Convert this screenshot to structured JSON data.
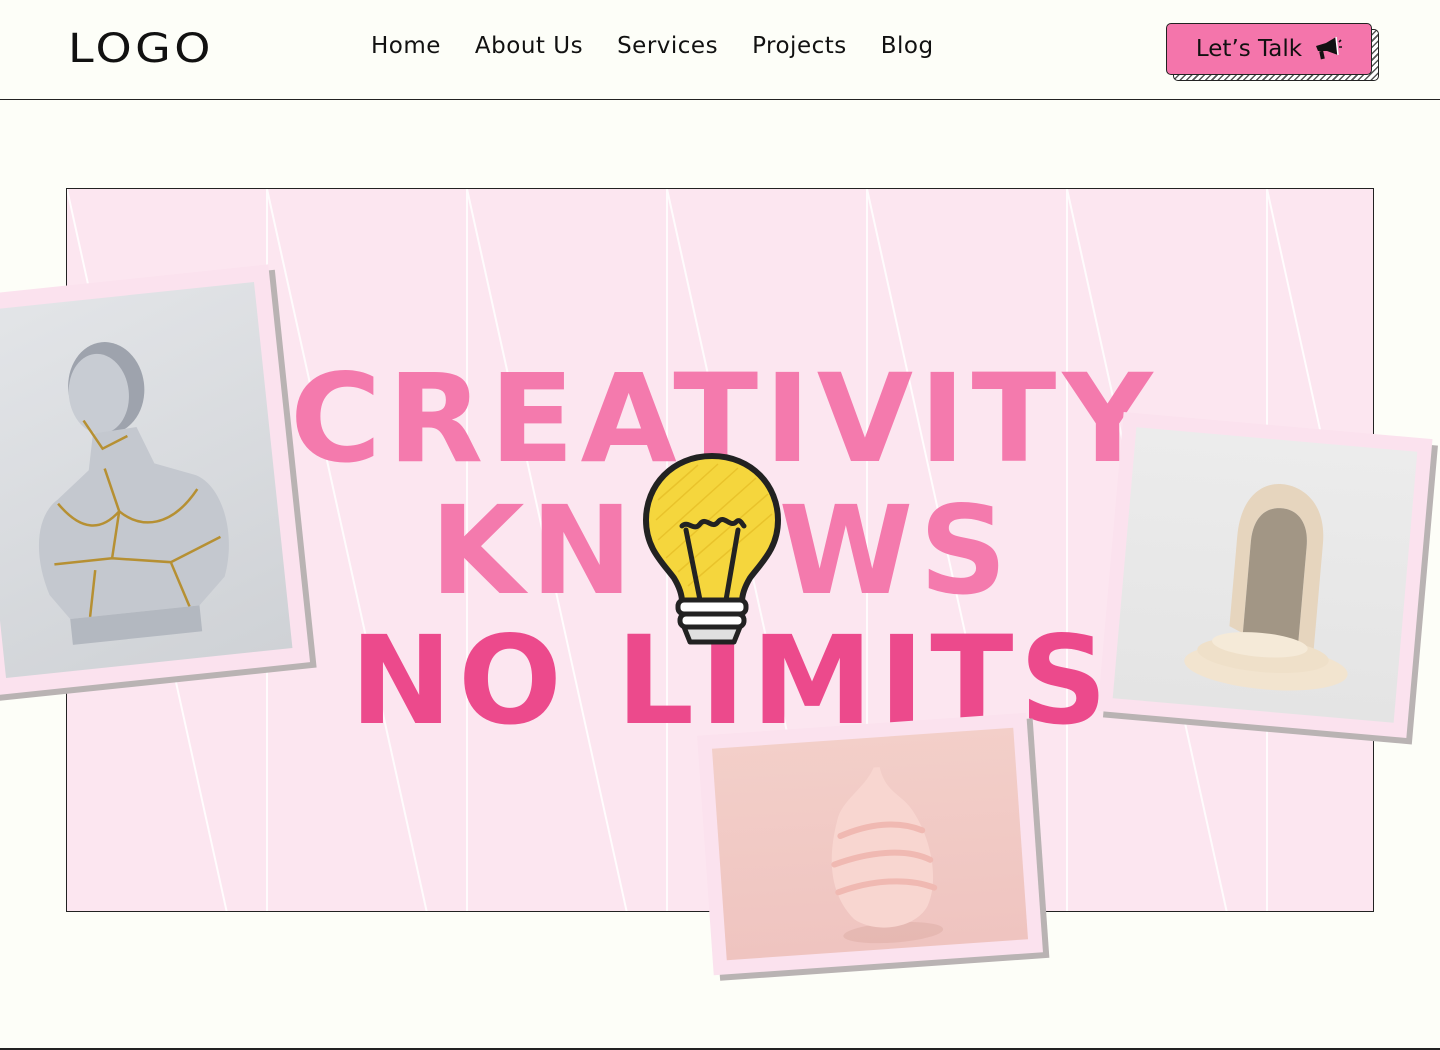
{
  "header": {
    "logo": "LOGO",
    "nav": [
      "Home",
      "About Us",
      "Services",
      "Projects",
      "Blog"
    ],
    "cta_label": "Let’s Talk",
    "cta_icon": "megaphone-icon"
  },
  "hero": {
    "line1": "CREATIVITY",
    "line2_left": "KN",
    "line2_right": "WS",
    "line3": "NO LIMITS",
    "bulb_icon": "lightbulb-icon",
    "colors": {
      "background": "#fce6f0",
      "headline_light": "#f47aad",
      "headline_dark": "#ec4a8c",
      "accent_button": "#f475ab",
      "bulb": "#f5d63d"
    }
  },
  "photos": [
    "marble-bust-photo",
    "arch-podium-photo",
    "cream-swirl-photo"
  ]
}
